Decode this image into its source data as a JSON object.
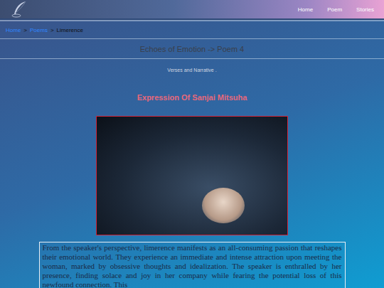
{
  "header": {
    "nav": [
      {
        "label": "Home"
      },
      {
        "label": "Poem"
      },
      {
        "label": "Stories"
      }
    ]
  },
  "breadcrumb": {
    "items": [
      {
        "label": "Home",
        "link": true
      },
      {
        "label": "Poems",
        "link": true
      },
      {
        "label": "Limerence",
        "link": false
      }
    ],
    "separator": ">"
  },
  "section_title": "Echoes of Emotion -> Poem 4",
  "subtitle": "Verses and Narrative .",
  "heading": "Expression Of Sanjai Mitsuha",
  "paragraph": "From the speaker's perspective, limerence manifests as an all-consuming passion that reshapes their emotional world. They experience an immediate and intense attraction upon meeting the woman, marked by obsessive thoughts and idealization. The speaker is enthralled by her presence, finding solace and joy in her company while fearing the potential loss of this newfound connection. This"
}
